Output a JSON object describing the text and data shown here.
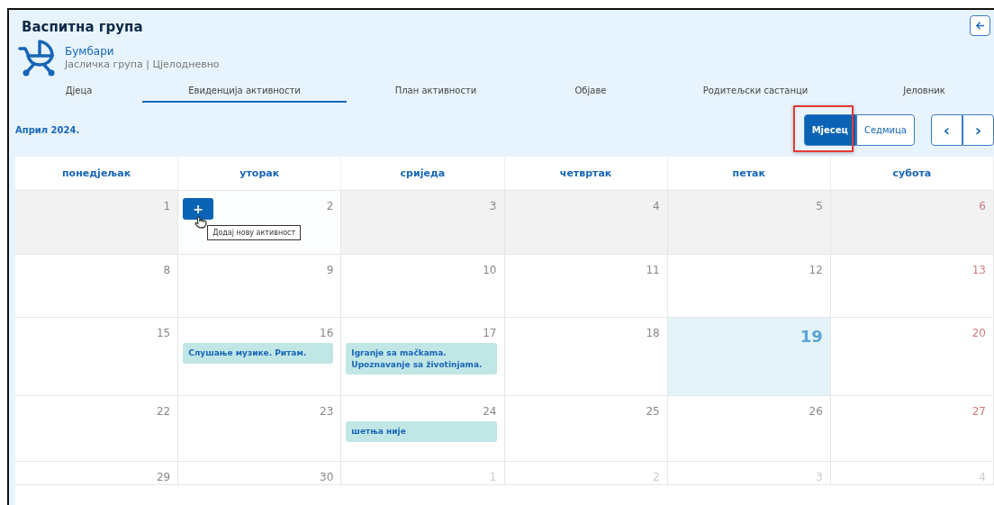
{
  "header": {
    "title": "Васпитна група",
    "group_name": "Бумбари",
    "group_info": "Јасличка група | Цјелодневно"
  },
  "tabs": [
    {
      "label": "Дјеца",
      "selected": false
    },
    {
      "label": "Евиденција активности",
      "selected": true
    },
    {
      "label": "План активности",
      "selected": false
    },
    {
      "label": "Објаве",
      "selected": false
    },
    {
      "label": "Родитељски састанци",
      "selected": false
    },
    {
      "label": "Јеловник",
      "selected": false
    }
  ],
  "toolbar": {
    "period": "Април 2024.",
    "views": [
      {
        "label": "Мјесец",
        "selected": true,
        "highlighted": true
      },
      {
        "label": "Седмица",
        "selected": false,
        "highlighted": false
      }
    ],
    "prev": "‹",
    "next": "›"
  },
  "calendar": {
    "weekdays": [
      "понедјељак",
      "уторак",
      "сриједа",
      "четвртак",
      "петак",
      "субота"
    ],
    "add_button": "+",
    "tooltip": "Додај нову активност",
    "weeks": [
      {
        "shaded": true,
        "days": [
          {
            "day": "1",
            "kind": "normal"
          },
          {
            "day": "2",
            "kind": "hovered"
          },
          {
            "day": "3",
            "kind": "normal"
          },
          {
            "day": "4",
            "kind": "normal"
          },
          {
            "day": "5",
            "kind": "normal"
          },
          {
            "day": "6",
            "kind": "weekend"
          }
        ]
      },
      {
        "shaded": false,
        "days": [
          {
            "day": "8",
            "kind": "normal"
          },
          {
            "day": "9",
            "kind": "normal"
          },
          {
            "day": "10",
            "kind": "normal"
          },
          {
            "day": "11",
            "kind": "normal"
          },
          {
            "day": "12",
            "kind": "normal"
          },
          {
            "day": "13",
            "kind": "weekend"
          }
        ]
      },
      {
        "shaded": false,
        "days": [
          {
            "day": "15",
            "kind": "normal"
          },
          {
            "day": "16",
            "kind": "normal",
            "events": [
              "Слушање музике. Ритам."
            ]
          },
          {
            "day": "17",
            "kind": "normal",
            "events": [
              "Igranje sa mačkama. Upoznavanje sa životinjama."
            ]
          },
          {
            "day": "18",
            "kind": "normal"
          },
          {
            "day": "19",
            "kind": "today"
          },
          {
            "day": "20",
            "kind": "weekend"
          }
        ]
      },
      {
        "shaded": false,
        "days": [
          {
            "day": "22",
            "kind": "normal"
          },
          {
            "day": "23",
            "kind": "normal"
          },
          {
            "day": "24",
            "kind": "normal",
            "events": [
              "шетња није"
            ]
          },
          {
            "day": "25",
            "kind": "normal"
          },
          {
            "day": "26",
            "kind": "normal"
          },
          {
            "day": "27",
            "kind": "weekend"
          }
        ]
      },
      {
        "shaded": false,
        "days": [
          {
            "day": "29",
            "kind": "normal"
          },
          {
            "day": "30",
            "kind": "normal"
          },
          {
            "day": "1",
            "kind": "other"
          },
          {
            "day": "2",
            "kind": "other"
          },
          {
            "day": "3",
            "kind": "other"
          },
          {
            "day": "4",
            "kind": "other"
          }
        ]
      }
    ]
  }
}
